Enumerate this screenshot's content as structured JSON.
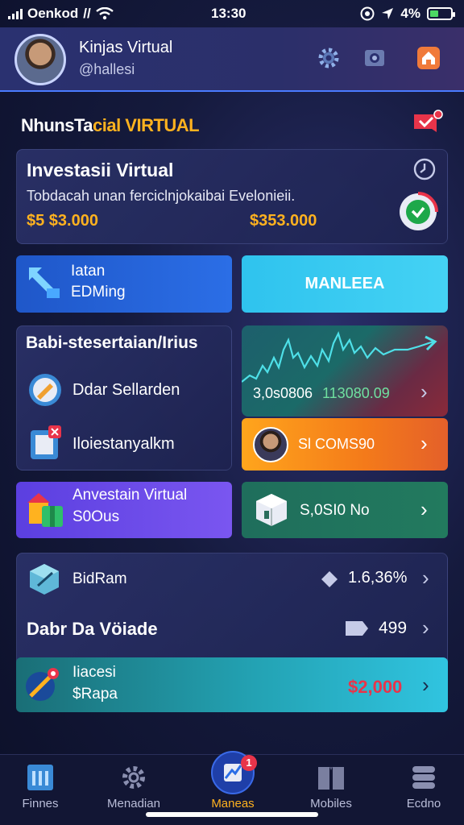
{
  "status": {
    "carrier": "Oenkod",
    "carrier_extra": "//",
    "time": "13:30",
    "battery": "4%",
    "battery_level": 0.4
  },
  "header": {
    "user_name": "Kinjas Virtual",
    "user_handle": "@hallesi"
  },
  "brand": {
    "part1": "NhunsTa",
    "part2": "cial VIRTUAL"
  },
  "investment": {
    "title": "Investasii Virtual",
    "description": "Tobdacah unan ferciclnjokaibai Evelonieii.",
    "value_left": "$5 $3.000",
    "value_right": "$353.000"
  },
  "actions": {
    "left_line1": "Iatan",
    "left_line2": "EDMing",
    "right_label": "MANLEEA"
  },
  "section": {
    "title": "Babi-stesertaian/Irius",
    "item1": "Ddar Sellarden",
    "item2": "Iloiestanyalkm"
  },
  "chart_card": {
    "value_white": "3,0s0806",
    "value_green": "113080.09"
  },
  "orange_card": {
    "label": "Sl COMS90"
  },
  "purple_card": {
    "line1": "Anvestain Virtual",
    "line2": "S0Ous"
  },
  "green_card": {
    "label": "S,0SI0 No"
  },
  "bottom": {
    "row1_label": "BidRam",
    "row1_value": "1.6,36%",
    "row2_label": "Dabr Da Vöiade",
    "row2_value": "499",
    "row3_line1": "Iiacesi",
    "row3_line2": "$Rapa",
    "row3_value": "$2,000"
  },
  "nav": {
    "items": [
      {
        "label": "Finnes"
      },
      {
        "label": "Menadian"
      },
      {
        "label": "Maneas"
      },
      {
        "label": "Mobiles"
      },
      {
        "label": "Ecdno"
      }
    ],
    "badge": "1"
  },
  "colors": {
    "accent": "#ffb21f",
    "blue": "#2b6ee6",
    "cyan": "#44d2f4",
    "orange": "#f47a1a",
    "purple": "#6a4ae8",
    "green": "#227a5e"
  }
}
